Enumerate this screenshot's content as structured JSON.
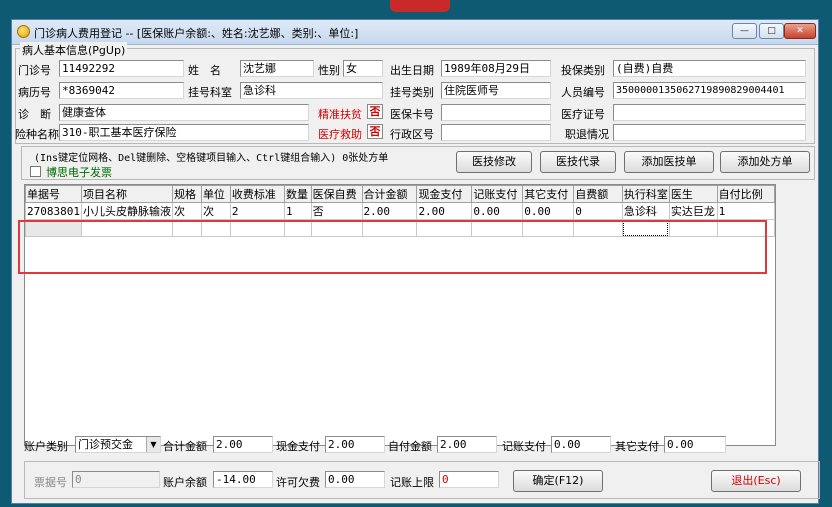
{
  "window": {
    "title": "门诊病人费用登记 -- [医保账户余额:、姓名:沈艺娜、类别:、单位:]",
    "minimize_icon": "minimize-icon",
    "maximize_icon": "maximize-icon",
    "close_icon": "close-icon"
  },
  "patient_group": {
    "title": "病人基本信息(PgUp)",
    "fields": {
      "clinic_no_label": "门诊号",
      "clinic_no": "11492292",
      "name_label": "姓　名",
      "name": "沈艺娜",
      "sex_label": "性别",
      "sex": "女",
      "birth_label": "出生日期",
      "birth": "1989年08月29日",
      "ins_type_label": "投保类别",
      "ins_type": "(自费)自费",
      "record_no_label": "病历号",
      "record_no": "*8369042",
      "dept_label": "挂号科室",
      "dept": "急诊科",
      "reg_type_label": "挂号类别",
      "reg_type": "住院医师号",
      "staff_no_label": "人员编号",
      "staff_no": "35000001350627198908290044​01",
      "diag_label": "诊　断",
      "diag": "健康查体",
      "poverty_label": "精准扶贫",
      "poverty_flag": "否",
      "ins_card_label": "医保卡号",
      "ins_card": "",
      "med_cert_label": "医疗证号",
      "med_cert": "",
      "ins_kind_label": "险种名称",
      "ins_kind": "310-职工基本医疗保险",
      "aid_label": "医疗救助",
      "aid_flag": "否",
      "district_label": "行政区号",
      "district": "",
      "retire_label": "职退情况",
      "retire": ""
    }
  },
  "toolbar": {
    "hint": "(Ins键定位网格、Del键删除、空格键项目输入、Ctrl键组合输入) 0张处方单",
    "einvoice_label": "博思电子发票",
    "btn_modify": "医技修改",
    "btn_order": "医技代录",
    "btn_add_tech": "添加医技单",
    "btn_add_rx": "添加处方单"
  },
  "grid": {
    "columns": [
      "单据号",
      "项目名称",
      "规格",
      "单位",
      "收费标准",
      "数量",
      "医保自费",
      "合计金额",
      "现金支付",
      "记账支付",
      "其它支付",
      "自费额",
      "执行科室",
      "医生",
      "自付比例"
    ],
    "rows": [
      [
        "27083801",
        "小儿头皮静脉输液",
        "次",
        "次",
        "2",
        "1",
        "否",
        "2.00",
        "2.00",
        "0.00",
        "0.00",
        "0",
        "急诊科",
        "实达巨龙",
        "1"
      ]
    ]
  },
  "summary": {
    "account_type_label": "账户类别",
    "account_type": "门诊预交金",
    "total_label": "合计金额",
    "total": "2.00",
    "cash_label": "现金支付",
    "cash": "2.00",
    "self_label": "自付金额",
    "self": "2.00",
    "charge_label": "记账支付",
    "charge": "0.00",
    "other_label": "其它支付",
    "other": "0.00"
  },
  "footer": {
    "receipt_label": "票据号",
    "receipt": "0",
    "balance_label": "账户余额",
    "balance": "-14.00",
    "owe_label": "许可欠费",
    "owe": "0.00",
    "limit_label": "记账上限",
    "limit": "0",
    "confirm_btn": "确定(F12)",
    "exit_btn": "退出(Esc)"
  },
  "colors": {
    "accent_red": "#d40000",
    "highlight_box": "#e0383c"
  }
}
